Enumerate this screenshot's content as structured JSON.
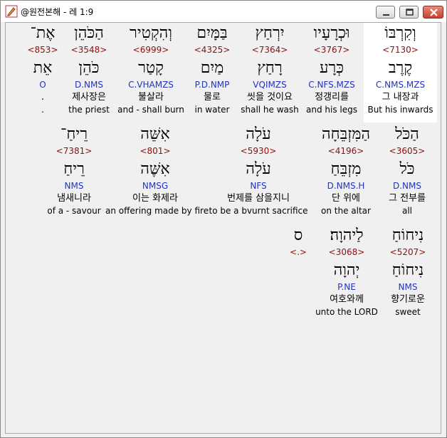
{
  "window": {
    "title": "@원전본해 - 레 1:9",
    "icon": "app-pencil-icon",
    "buttons": [
      "minimize",
      "maximize",
      "close"
    ]
  },
  "words": [
    {
      "hebrew": "וְקִרְבּוֹ",
      "strong": "<7130>",
      "root": "קֶרֶב",
      "morph": "C.NMS.MZS",
      "korean": "그 내장과",
      "english": "But his inwards",
      "selected": true
    },
    {
      "hebrew": "וּכְרָעָיו",
      "strong": "<3767>",
      "root": "כְּרָע",
      "morph": "C.NFS.MZS",
      "korean": "정갱리를",
      "english": "and his legs"
    },
    {
      "hebrew": "יִרְחַץ",
      "strong": "<7364>",
      "root": "רָחַץ",
      "morph": "VQIMZS",
      "korean": "씻을 것이요",
      "english": "shall he wash"
    },
    {
      "hebrew": "בַּמָּיִם",
      "strong": "<4325>",
      "root": "מַיִם",
      "morph": "P.D.NMP",
      "korean": "물로",
      "english": "in water"
    },
    {
      "hebrew": "וְהִקְטִיר",
      "strong": "<6999>",
      "root": "קָטַר",
      "morph": "C.VHAMZS",
      "korean": "불살라",
      "english": "and - shall burn"
    },
    {
      "hebrew": "הַכֹּהֵן",
      "strong": "<3548>",
      "root": "כֹּהֵן",
      "morph": "D.NMS",
      "korean": "제사장은",
      "english": "the priest"
    },
    {
      "hebrew": "אֶת־",
      "strong": "<853>",
      "root": "אֵת",
      "morph": "O",
      "korean": ".",
      "english": "."
    },
    {
      "hebrew": "הַכֹּל",
      "strong": "<3605>",
      "root": "כֹּל",
      "morph": "D.NMS",
      "korean": "그 전부를",
      "english": "all"
    },
    {
      "hebrew": "הַמִּזְבֵּחָה",
      "strong": "<4196>",
      "root": "מִזְבֵּחַ",
      "morph": "D.NMS.H",
      "korean": "단 위에",
      "english": "on the altar"
    },
    {
      "hebrew": "עֹלָה",
      "strong": "<5930>",
      "root": "עֹלָה",
      "morph": "NFS",
      "korean": "번제를 삼을지니",
      "english": "to be a bvurnt sacrifice"
    },
    {
      "hebrew": "אִשֵּׁה",
      "strong": "<801>",
      "root": "אִשֶּׁה",
      "morph": "NMSG",
      "korean": "이는 화제라",
      "english": "an offering made by fire"
    },
    {
      "hebrew": "רֵיחַ־",
      "strong": "<7381>",
      "root": "רֵיחַ",
      "morph": "NMS",
      "korean": "냄새니라",
      "english": "of a - savour"
    },
    {
      "hebrew": "נִיחוֹחַ",
      "strong": "<5207>",
      "root": "נִיחוֹחַ",
      "morph": "NMS",
      "korean": "향기로운",
      "english": "sweet"
    },
    {
      "hebrew": "לַיהוָה׃",
      "strong": "<3068>",
      "root": "יְהוָה",
      "morph": "P.NE",
      "korean": "여호와께",
      "english": "unto the LORD"
    },
    {
      "hebrew": "ס",
      "strong": "<.>",
      "root": "",
      "morph": "",
      "korean": "",
      "english": ""
    }
  ]
}
